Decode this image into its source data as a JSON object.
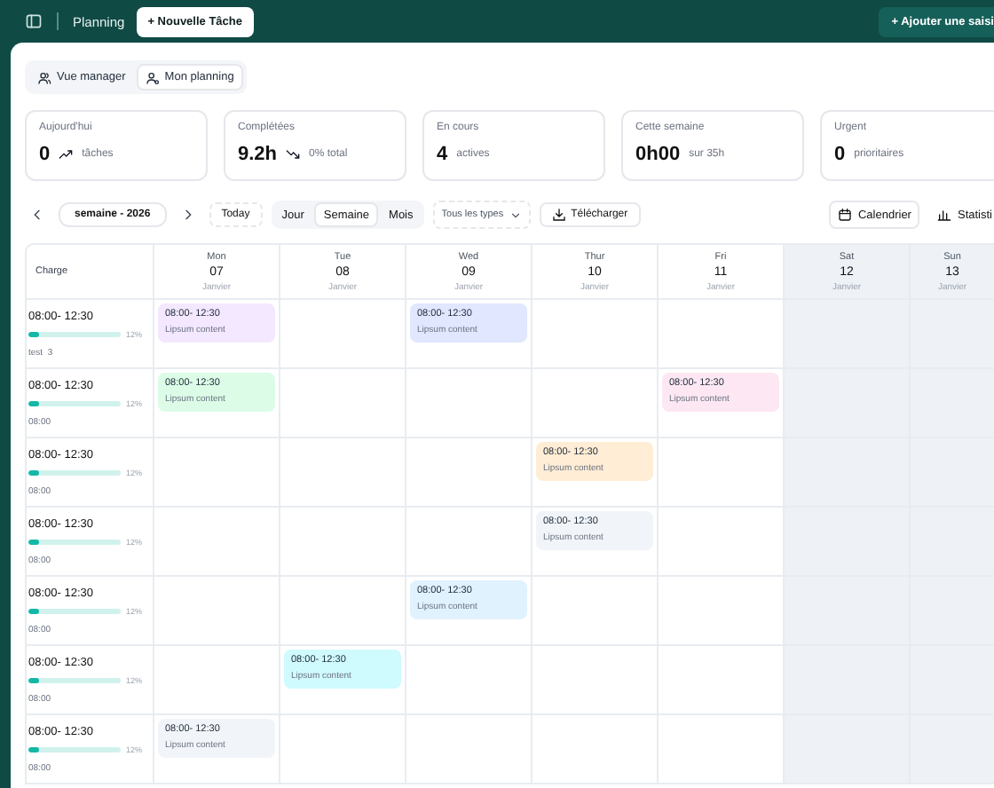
{
  "topbar": {
    "title": "Planning",
    "new_task": "+ Nouvelle Tâche",
    "add_entry": "+ Ajouter une saisi"
  },
  "views": [
    {
      "label": "Vue manager",
      "selected": false
    },
    {
      "label": "Mon planning",
      "selected": true
    }
  ],
  "stats": [
    {
      "label": "Aujourd'hui",
      "value": "0",
      "kind": "up",
      "note": "tâches"
    },
    {
      "label": "Complétées",
      "value": "9.2h",
      "kind": "down",
      "note": "0% total"
    },
    {
      "label": "En cours",
      "value": "4",
      "kind": "plain",
      "note": "actives"
    },
    {
      "label": "Cette semaine",
      "value": "0h00",
      "kind": "plain",
      "note": "sur 35h"
    },
    {
      "label": "Urgent",
      "value": "0",
      "kind": "plain",
      "note": "prioritaires"
    }
  ],
  "toolbar": {
    "period": "semaine - 2026",
    "today": "Today",
    "filter": "Tous les types",
    "download": "Télécharger"
  },
  "modes": [
    {
      "label": "Jour",
      "selected": false
    },
    {
      "label": "Semaine",
      "selected": true
    },
    {
      "label": "Mois",
      "selected": false
    }
  ],
  "display_tabs": [
    {
      "label": "Calendrier",
      "selected": true,
      "kind": "calendar"
    },
    {
      "label": "Statisti",
      "selected": false,
      "kind": "chart"
    }
  ],
  "calendar": {
    "corner": "Charge",
    "days": [
      {
        "name": "Mon",
        "date": "07",
        "month": "Janvier",
        "weekend": false
      },
      {
        "name": "Tue",
        "date": "08",
        "month": "Janvier",
        "weekend": false
      },
      {
        "name": "Wed",
        "date": "09",
        "month": "Janvier",
        "weekend": false
      },
      {
        "name": "Thur",
        "date": "10",
        "month": "Janvier",
        "weekend": false
      },
      {
        "name": "Fri",
        "date": "11",
        "month": "Janvier",
        "weekend": false
      },
      {
        "name": "Sat",
        "date": "12",
        "month": "Janvier",
        "weekend": true
      },
      {
        "name": "Sun",
        "date": "13",
        "month": "Janvier",
        "weekend": true
      }
    ],
    "rows": [
      {
        "time": "08:00- 12:30",
        "level": 0.12,
        "reading": "12%",
        "sub": "test  3",
        "cells": [
          {
            "kind": "event",
            "time": "08:00- 12:30",
            "text": "Lipsum content",
            "color": "#f3e8ff"
          },
          {
            "kind": "empty"
          },
          {
            "kind": "event",
            "time": "08:00- 12:30",
            "text": "Lipsum content",
            "color": "#e0e7ff"
          },
          {
            "kind": "empty"
          },
          {
            "kind": "empty"
          },
          {
            "kind": "empty"
          },
          {
            "kind": "empty"
          }
        ]
      },
      {
        "time": "08:00- 12:30",
        "level": 0.12,
        "reading": "12%",
        "sub": "08:00",
        "cells": [
          {
            "kind": "event",
            "time": "08:00- 12:30",
            "text": "Lipsum content",
            "color": "#dcfce7"
          },
          {
            "kind": "empty"
          },
          {
            "kind": "empty"
          },
          {
            "kind": "empty"
          },
          {
            "kind": "event",
            "time": "08:00- 12:30",
            "text": "Lipsum content",
            "color": "#fce7f3"
          },
          {
            "kind": "empty"
          },
          {
            "kind": "empty"
          }
        ]
      },
      {
        "time": "08:00- 12:30",
        "level": 0.12,
        "reading": "12%",
        "sub": "08:00",
        "cells": [
          {
            "kind": "empty"
          },
          {
            "kind": "empty"
          },
          {
            "kind": "empty"
          },
          {
            "kind": "event",
            "time": "08:00- 12:30",
            "text": "Lipsum content",
            "color": "#ffedd5"
          },
          {
            "kind": "empty"
          },
          {
            "kind": "empty"
          },
          {
            "kind": "empty"
          }
        ]
      },
      {
        "time": "08:00- 12:30",
        "level": 0.12,
        "reading": "12%",
        "sub": "08:00",
        "cells": [
          {
            "kind": "empty"
          },
          {
            "kind": "empty"
          },
          {
            "kind": "empty"
          },
          {
            "kind": "event",
            "time": "08:00- 12:30",
            "text": "Lipsum content",
            "color": "#f1f5f9"
          },
          {
            "kind": "empty"
          },
          {
            "kind": "empty"
          },
          {
            "kind": "empty"
          }
        ]
      },
      {
        "time": "08:00- 12:30",
        "level": 0.12,
        "reading": "12%",
        "sub": "08:00",
        "cells": [
          {
            "kind": "empty"
          },
          {
            "kind": "empty"
          },
          {
            "kind": "event",
            "time": "08:00- 12:30",
            "text": "Lipsum content",
            "color": "#e0f2fe"
          },
          {
            "kind": "empty"
          },
          {
            "kind": "empty"
          },
          {
            "kind": "empty"
          },
          {
            "kind": "empty"
          }
        ]
      },
      {
        "time": "08:00- 12:30",
        "level": 0.12,
        "reading": "12%",
        "sub": "08:00",
        "cells": [
          {
            "kind": "empty"
          },
          {
            "kind": "event",
            "time": "08:00- 12:30",
            "text": "Lipsum content",
            "color": "#cffafe"
          },
          {
            "kind": "empty"
          },
          {
            "kind": "empty"
          },
          {
            "kind": "empty"
          },
          {
            "kind": "empty"
          },
          {
            "kind": "empty"
          }
        ]
      },
      {
        "time": "08:00- 12:30",
        "level": 0.12,
        "reading": "12%",
        "sub": "08:00",
        "cells": [
          {
            "kind": "event",
            "time": "08:00- 12:30",
            "text": "Lipsum content",
            "color": "#f1f5f9"
          },
          {
            "kind": "empty"
          },
          {
            "kind": "empty"
          },
          {
            "kind": "empty"
          },
          {
            "kind": "empty"
          },
          {
            "kind": "empty"
          },
          {
            "kind": "empty"
          }
        ]
      }
    ]
  }
}
